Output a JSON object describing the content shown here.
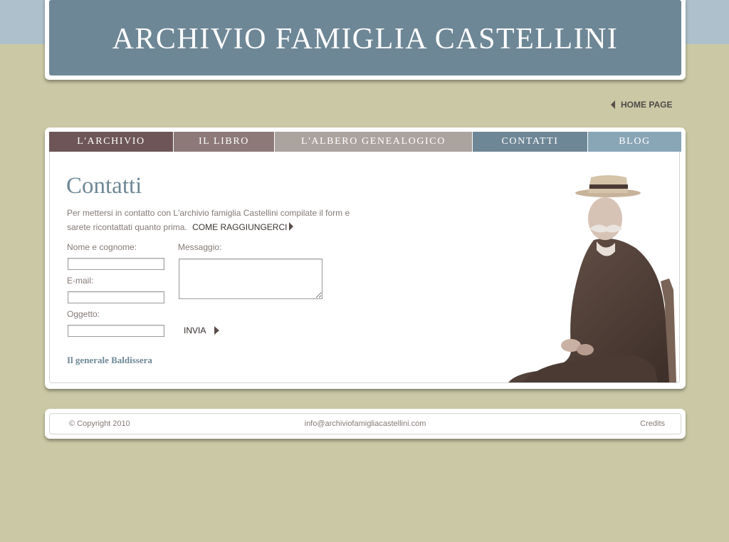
{
  "site": {
    "title": "ARCHIVIO FAMIGLIA CASTELLINI"
  },
  "home_link": {
    "label": "HOME PAGE"
  },
  "nav": {
    "items": [
      {
        "label": "L'ARCHIVIO",
        "color": "#6e5658"
      },
      {
        "label": "IL LIBRO",
        "color": "#8c7978"
      },
      {
        "label": "L'ALBERO GENEALOGICO",
        "color": "#aba39e"
      },
      {
        "label": "CONTATTI",
        "color": "#6e8796"
      },
      {
        "label": "BLOG",
        "color": "#89a6b7"
      }
    ]
  },
  "page": {
    "title": "Contatti",
    "intro": "Per mettersi in contatto con L'archivio famiglia Castellini compilate il form e sarete ricontattati quanto prima.",
    "route_link": "COME RAGGIUNGERCI",
    "caption": "Il generale Baldissera"
  },
  "form": {
    "name_label": "Nome e cognome:",
    "name_value": "",
    "email_label": "E-mail:",
    "email_value": "",
    "subject_label": "Oggetto:",
    "subject_value": "",
    "message_label": "Messaggio:",
    "message_value": "",
    "submit_label": "INVIA"
  },
  "footer": {
    "copyright": "© Copyright 2010",
    "email": "info@archiviofamigliacastellini.com",
    "credits": "Credits"
  },
  "colors": {
    "page_bg": "#cbc9a5",
    "header_bg": "#6e8796",
    "top_band": "#aec0cc",
    "accent": "#6e8796"
  }
}
